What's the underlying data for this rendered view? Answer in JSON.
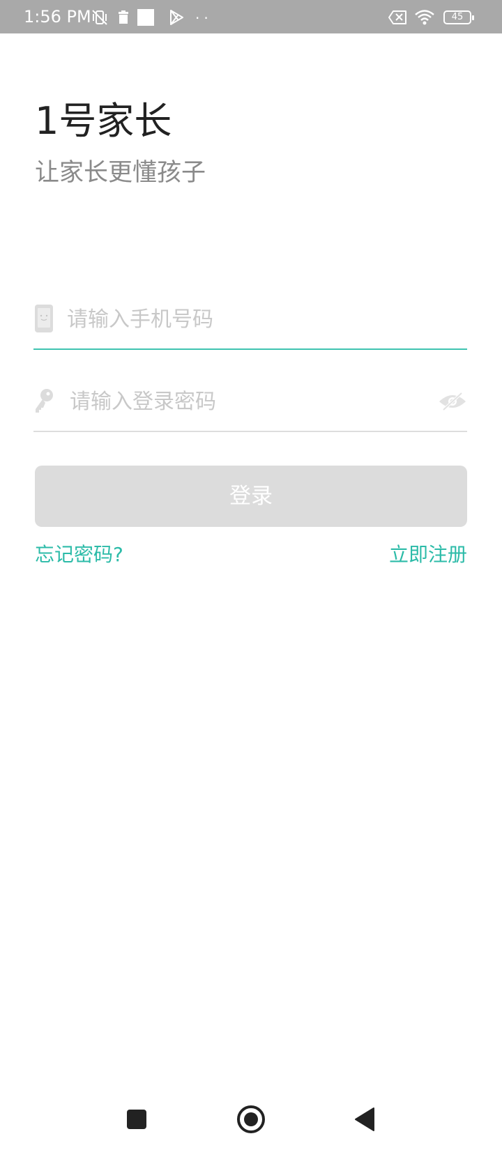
{
  "status_bar": {
    "time": "1:56 PM",
    "dots": "··",
    "battery_level": "45",
    "icons": [
      "vibrate-off-icon",
      "trash-icon",
      "square-notification-icon",
      "play-store-icon",
      "no-sim-icon",
      "wifi-icon",
      "battery-icon"
    ]
  },
  "header": {
    "title": "1号家长",
    "subtitle": "让家长更懂孩子"
  },
  "form": {
    "phone": {
      "value": "",
      "placeholder": "请输入手机号码",
      "icon": "phone-icon"
    },
    "password": {
      "value": "",
      "placeholder": "请输入登录密码",
      "icon": "key-icon",
      "toggle_icon": "eye-off-icon"
    },
    "login_label": "登录"
  },
  "links": {
    "forgot_password": "忘记密码?",
    "register": "立即注册"
  },
  "colors": {
    "accent": "#2cbba8",
    "active_underline": "#3ec3b0",
    "button_disabled": "#dcdcdc",
    "status_bar": "#a9a9a9"
  },
  "nav_bar": {
    "icons": [
      "recents-icon",
      "home-icon",
      "back-icon"
    ]
  }
}
